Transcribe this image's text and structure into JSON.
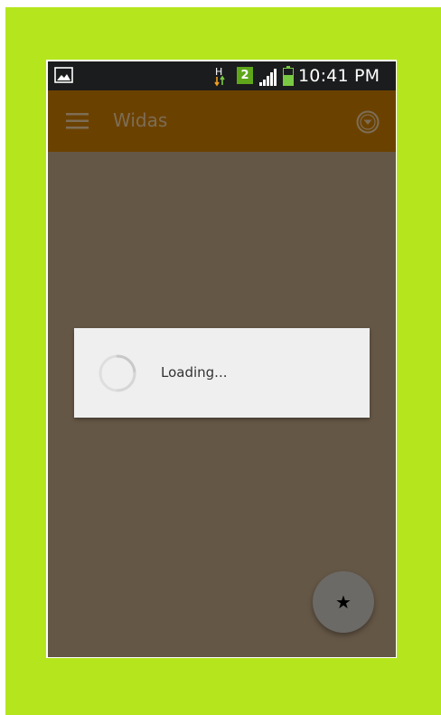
{
  "status_bar": {
    "time": "10:41 PM",
    "sim_slot": "2",
    "network_type": "H",
    "icons": [
      "gallery-notification-icon",
      "hspa-data-icon",
      "sim-2-icon",
      "signal-strength-icon",
      "battery-icon"
    ]
  },
  "app_bar": {
    "title": "Widas",
    "menu_icon": "hamburger-menu-icon",
    "action_icon": "circle-chevron-down-icon",
    "background_color": "#6b4100"
  },
  "dialog": {
    "message": "Loading...",
    "indicator": "loading-spinner"
  },
  "fab": {
    "icon": "star-icon",
    "glyph": "★"
  },
  "colors": {
    "outer_background": "#b5e61d",
    "screen_scrim": "#655746",
    "dialog_background": "#efefef",
    "fab_background": "#6b6a67",
    "title_color": "#7d6d55"
  }
}
